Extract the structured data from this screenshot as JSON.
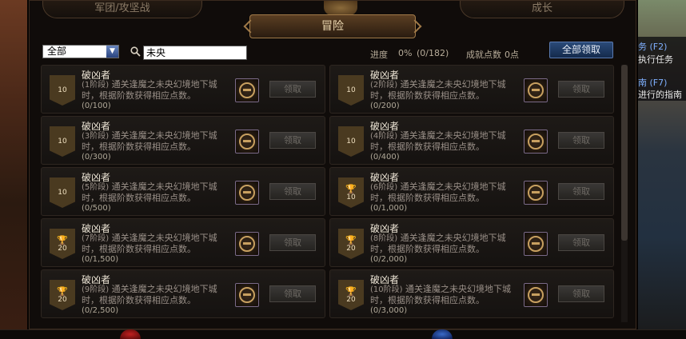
{
  "background": {
    "right_panel_lines": [
      {
        "label": "务 (F2)",
        "kind": "key"
      },
      {
        "label": "执行任务",
        "kind": "text"
      },
      {
        "label": "南 (F7)",
        "kind": "key"
      },
      {
        "label": "进行的指南",
        "kind": "text"
      }
    ]
  },
  "tabs": {
    "left": "军团/攻坚战",
    "right": "成长",
    "active": "冒险"
  },
  "toolbar": {
    "filter_value": "全部",
    "search_value": "未央",
    "progress_label": "进度",
    "progress_value": "0%",
    "progress_count": "(0/182)",
    "points_label": "成就点数",
    "points_value": "0点",
    "claim_all_label": "全部领取"
  },
  "achievements": [
    {
      "title": "破凶者",
      "badge": "10",
      "cup": false,
      "stage": "(1阶段)",
      "desc": "通关逢魔之未央幻境地下城时，根据阶数获得相应点数。",
      "progress": "(0/100)",
      "claim_label": "领取"
    },
    {
      "title": "破凶者",
      "badge": "10",
      "cup": false,
      "stage": "(2阶段)",
      "desc": "通关逢魔之未央幻境地下城时，根据阶数获得相应点数。",
      "progress": "(0/200)",
      "claim_label": "领取"
    },
    {
      "title": "破凶者",
      "badge": "10",
      "cup": false,
      "stage": "(3阶段)",
      "desc": "通关逢魔之未央幻境地下城时，根据阶数获得相应点数。",
      "progress": "(0/300)",
      "claim_label": "领取"
    },
    {
      "title": "破凶者",
      "badge": "10",
      "cup": false,
      "stage": "(4阶段)",
      "desc": "通关逢魔之未央幻境地下城时，根据阶数获得相应点数。",
      "progress": "(0/400)",
      "claim_label": "领取"
    },
    {
      "title": "破凶者",
      "badge": "10",
      "cup": false,
      "stage": "(5阶段)",
      "desc": "通关逢魔之未央幻境地下城时，根据阶数获得相应点数。",
      "progress": "(0/500)",
      "claim_label": "领取"
    },
    {
      "title": "破凶者",
      "badge": "10",
      "cup": true,
      "stage": "(6阶段)",
      "desc": "通关逢魔之未央幻境地下城时，根据阶数获得相应点数。",
      "progress": "(0/1,000)",
      "claim_label": "领取"
    },
    {
      "title": "破凶者",
      "badge": "20",
      "cup": true,
      "stage": "(7阶段)",
      "desc": "通关逢魔之未央幻境地下城时，根据阶数获得相应点数。",
      "progress": "(0/1,500)",
      "claim_label": "领取"
    },
    {
      "title": "破凶者",
      "badge": "20",
      "cup": true,
      "stage": "(8阶段)",
      "desc": "通关逢魔之未央幻境地下城时，根据阶数获得相应点数。",
      "progress": "(0/2,000)",
      "claim_label": "领取"
    },
    {
      "title": "破凶者",
      "badge": "20",
      "cup": true,
      "stage": "(9阶段)",
      "desc": "通关逢魔之未央幻境地下城时，根据阶数获得相应点数。",
      "progress": "(0/2,500)",
      "claim_label": "领取"
    },
    {
      "title": "破凶者",
      "badge": "20",
      "cup": true,
      "stage": "(10阶段)",
      "desc": "通关逢魔之未央幻境地下城时，根据阶数获得相应点数。",
      "progress": "(0/3,000)",
      "claim_label": "领取"
    }
  ]
}
